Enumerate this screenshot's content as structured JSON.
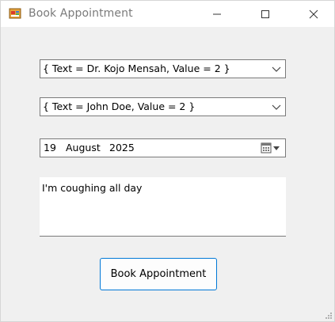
{
  "window": {
    "title": "Book Appointment",
    "icons": {
      "app": "app-form-icon",
      "minimize": "minimize-icon",
      "maximize": "maximize-icon",
      "close": "close-icon"
    }
  },
  "form": {
    "doctor_combo": {
      "value": "{ Text = Dr. Kojo Mensah, Value = 2 }"
    },
    "patient_combo": {
      "value": "{ Text = John Doe, Value = 2 }"
    },
    "date_picker": {
      "day": "19",
      "month": "August",
      "year": "2025"
    },
    "notes": {
      "value": "I'm coughing all day"
    },
    "book_button": {
      "label": "Book Appointment"
    }
  },
  "colors": {
    "window_bg": "#f0f0f0",
    "titlebar_bg": "#ffffff",
    "accent": "#0078d7",
    "field_border": "#7a7a7a"
  }
}
